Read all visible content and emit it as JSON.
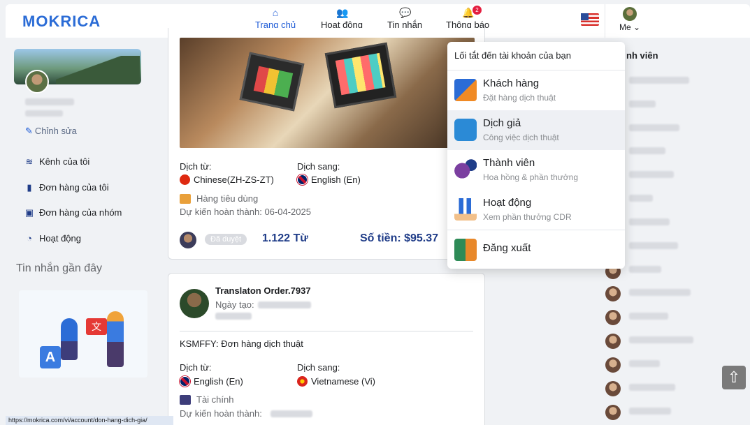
{
  "brand": {
    "logo_text": "MOKRICA"
  },
  "nav": {
    "items": [
      {
        "label": "Trang chủ",
        "icon": "home-icon"
      },
      {
        "label": "Hoạt động",
        "icon": "users-icon"
      },
      {
        "label": "Tin nhắn",
        "icon": "chat-icon"
      },
      {
        "label": "Thông báo",
        "icon": "bell-icon",
        "badge": "2"
      }
    ],
    "me_label": "Me",
    "language_flag": "us-flag-icon"
  },
  "sidebar": {
    "edit_label": "Chỉnh sửa",
    "items": [
      {
        "label": "Kênh của tôi",
        "icon": "layers-icon"
      },
      {
        "label": "Đơn hàng của tôi",
        "icon": "document-icon"
      },
      {
        "label": "Đơn hàng của nhóm",
        "icon": "briefcase-icon"
      },
      {
        "label": "Hoạt động",
        "icon": "pie-chart-icon"
      }
    ],
    "recent_messages_heading": "Tin nhắn gần đây"
  },
  "feed": {
    "card1": {
      "from_label": "Dịch từ:",
      "from_lang": "Chinese(ZH-ZS-ZT)",
      "to_label": "Dịch sang:",
      "to_lang": "English (En)",
      "category": "Hàng tiêu dùng",
      "due": "Dự kiến hoàn thành: 06-04-2025",
      "status": "Đã duyệt",
      "words": "1.122 Từ",
      "amount": "Số tiền: $95.37"
    },
    "card2": {
      "title": "Translaton Order.7937",
      "created_label": "Ngày tạo:",
      "description": "KSMFFY: Đơn hàng dịch thuật",
      "from_label": "Dịch từ:",
      "from_lang": "English (En)",
      "to_label": "Dịch sang:",
      "to_lang": "Vietnamese (Vi)",
      "category": "Tài chính",
      "due_label": "Dự kiến hoàn thành:"
    }
  },
  "dropdown": {
    "title": "Lối tắt đến tài khoản của bạn",
    "items": [
      {
        "label": "Khách hàng",
        "sub": "Đặt hàng dịch thuật",
        "icon": "translate-icon"
      },
      {
        "label": "Dịch giả",
        "sub": "Công việc dịch thuật",
        "icon": "briefcase-icon"
      },
      {
        "label": "Thành viên",
        "sub": "Hoa hồng & phần thưởng",
        "icon": "member-icon"
      },
      {
        "label": "Hoạt động",
        "sub": "Xem phần thưởng CDR",
        "icon": "growth-icon"
      },
      {
        "label": "Đăng xuất",
        "sub": "",
        "icon": "logout-icon"
      }
    ]
  },
  "right": {
    "heading_fragment": "nh viên"
  },
  "status_url": "https://mokrica.com/vi/account/don-hang-dich-gia/"
}
